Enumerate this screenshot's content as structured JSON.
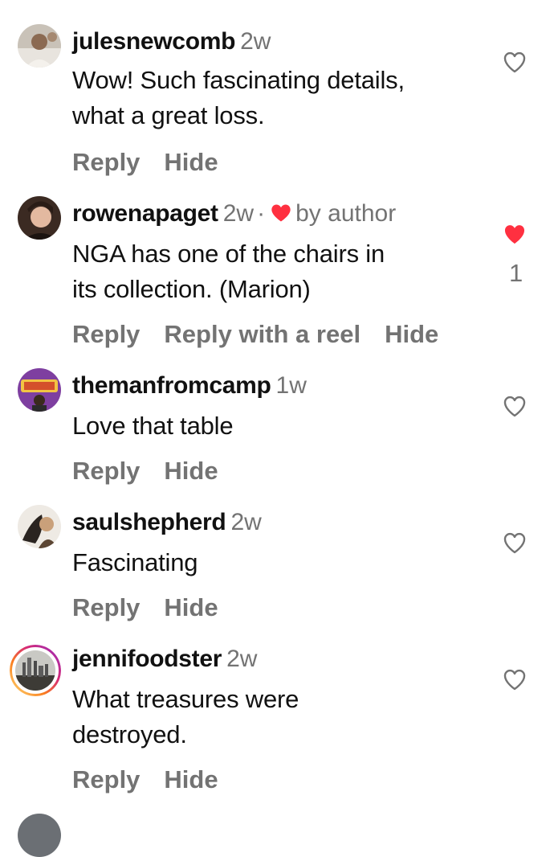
{
  "comments": [
    {
      "username": "julesnewcomb",
      "time": "2w",
      "text": "Wow! Such fascinating details, what a great loss.",
      "text_lines": [
        "Wow! Such fascinating details,",
        "what a great loss."
      ],
      "actions": [
        "Reply",
        "Hide"
      ],
      "liked": false
    },
    {
      "username": "rowenapaget",
      "time": "2w",
      "author_badge": "by author",
      "text_lines": [
        "NGA has one of the chairs in",
        "its collection. (Marion)"
      ],
      "actions": [
        "Reply",
        "Reply with a reel",
        "Hide"
      ],
      "liked": true,
      "like_count": "1"
    },
    {
      "username": "themanfromcamp",
      "time": "1w",
      "text_lines": [
        "Love that table"
      ],
      "actions": [
        "Reply",
        "Hide"
      ],
      "liked": false
    },
    {
      "username": "saulshepherd",
      "time": "2w",
      "text_lines": [
        "Fascinating"
      ],
      "actions": [
        "Reply",
        "Hide"
      ],
      "liked": false
    },
    {
      "username": "jennifoodster",
      "time": "2w",
      "text_lines": [
        "What treasures were",
        "destroyed."
      ],
      "actions": [
        "Reply",
        "Hide"
      ],
      "liked": false
    }
  ],
  "colors": {
    "text": "#111111",
    "secondary": "#737373",
    "like_red": "#ff3040"
  }
}
